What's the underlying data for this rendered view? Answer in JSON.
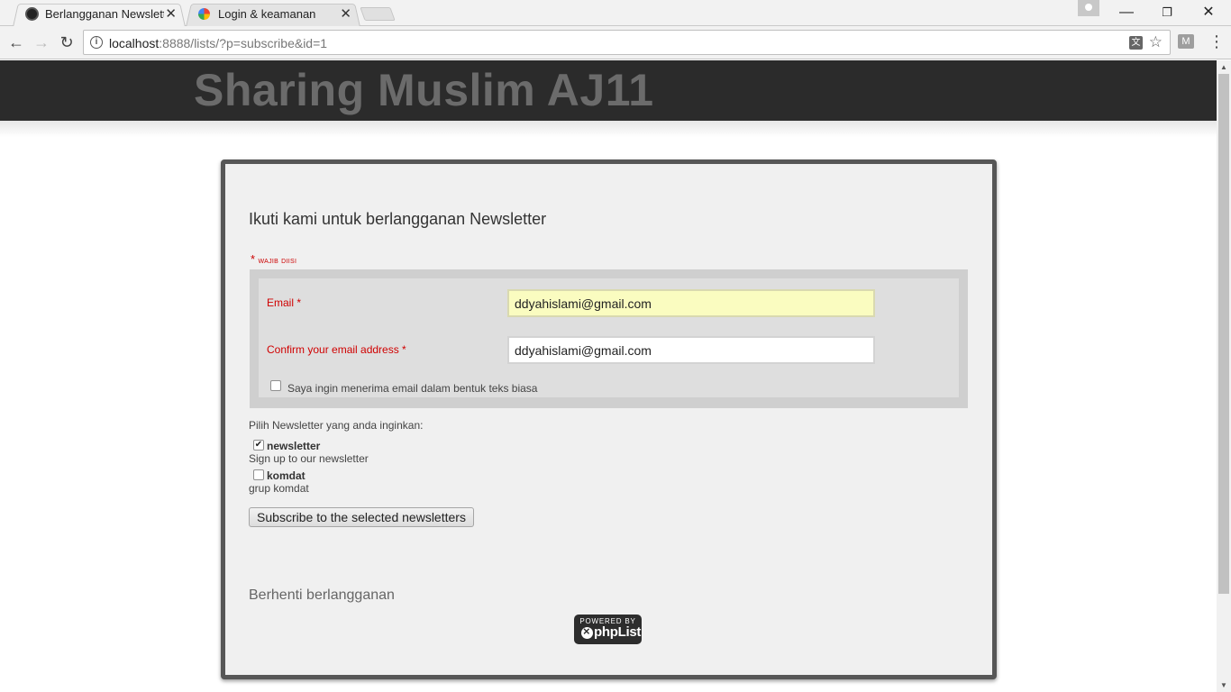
{
  "browser": {
    "tabs": [
      {
        "title": "Berlangganan Newsletter",
        "favicon": "phplist-favicon",
        "active": true
      },
      {
        "title": "Login & keamanan",
        "favicon": "google-favicon",
        "active": false
      }
    ],
    "url_host": "localhost",
    "url_path": ":8888/lists/?p=subscribe&id=1",
    "ext_label": "M",
    "translate_label": "文"
  },
  "site": {
    "title": "Sharing Muslim AJ11"
  },
  "form": {
    "heading": "Ikuti kami untuk berlangganan Newsletter",
    "required_star": "*",
    "required_note": "wajib diisi",
    "email_label": "Email *",
    "email_value": "ddyahislami@gmail.com",
    "confirm_label": "Confirm your email address *",
    "confirm_value": "ddyahislami@gmail.com",
    "plain_text_label": "Saya ingin menerima email dalam bentuk teks biasa",
    "plain_text_checked": false,
    "lists_label": "Pilih Newsletter yang anda inginkan:",
    "lists": [
      {
        "name": "newsletter",
        "description": "Sign up to our newsletter",
        "checked": true
      },
      {
        "name": "komdat",
        "description": "grup komdat",
        "checked": false
      }
    ],
    "submit_label": "Subscribe to the selected newsletters",
    "unsubscribe_label": "Berhenti berlangganan"
  },
  "footer": {
    "powered_by": "POWERED BY",
    "brand": "phpList"
  },
  "colors": {
    "header_bg": "#2b2b2b",
    "required_red": "#d00000",
    "email_field_bg": "#fafcc0"
  }
}
